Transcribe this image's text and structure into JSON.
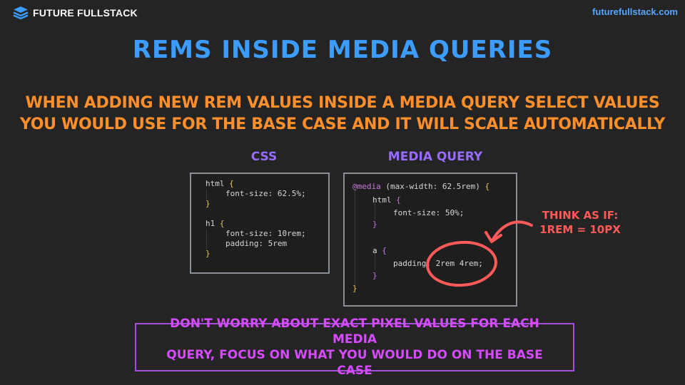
{
  "brand": {
    "name": "FUTURE FULLSTACK",
    "icon": "stacked-layers-icon"
  },
  "site_url": "futurefullstack.com",
  "title": "REMS INSIDE MEDIA QUERIES",
  "subtitle": {
    "line1": "WHEN ADDING NEW REM VALUES INSIDE A MEDIA QUERY SELECT VALUES",
    "line2": "YOU WOULD USE FOR THE BASE CASE AND IT WILL SCALE AUTOMATICALLY"
  },
  "css_label": "CSS",
  "media_query_label": "MEDIA QUERY",
  "css_code": {
    "l1_sel": "html",
    "l1_brace": "{",
    "l2": "font-size: 62.5%;",
    "l3": "}",
    "l4_sel": "h1",
    "l4_brace": "{",
    "l5": "font-size: 10rem;",
    "l6": "padding: 5rem",
    "l7": "}"
  },
  "mq_code": {
    "l1_at": "@media",
    "l1_rest": "(max-width: 62.5rem)",
    "l1_brace": "{",
    "l2_sel": "html",
    "l2_brace": "{",
    "l3": "font-size: 50%;",
    "l4": "}",
    "l5_sel": "a",
    "l5_brace": "{",
    "l6_prop": "padding:",
    "l6_val": "2rem 4rem;",
    "l7": "}",
    "l8": "}"
  },
  "annotation": {
    "line1": "THINK AS IF:",
    "line2": "1rem = 10px",
    "color": "#ff5a5a"
  },
  "bottom_note": {
    "line1": "DON'T WORRY ABOUT EXACT PIXEL VALUES FOR EACH MEDIA",
    "line2": "QUERY, FOCUS ON WHAT YOU WOULD DO ON THE BASE CASE"
  },
  "colors": {
    "background": "#242424",
    "title": "#3d9cff",
    "subtitle": "#ff8f2a",
    "labels": "#9a6bff",
    "bottom": "#d64bff"
  }
}
